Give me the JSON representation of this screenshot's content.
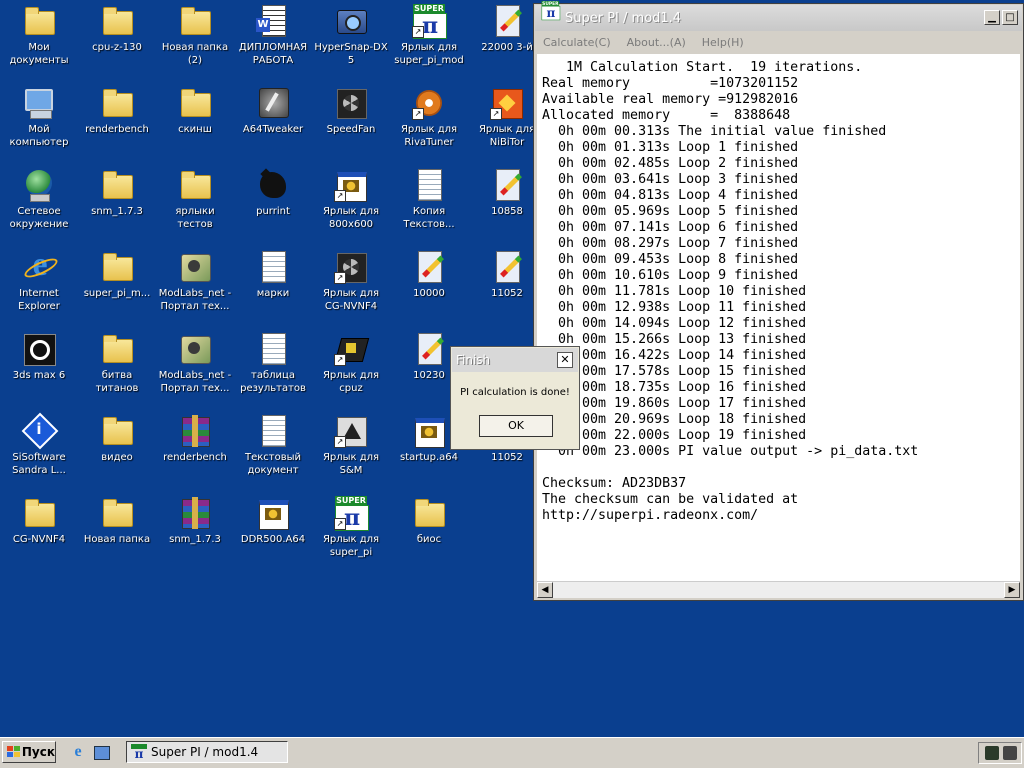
{
  "desktop": {
    "icons": [
      {
        "label": "Мои\nдокументы"
      },
      {
        "label": "cpu-z-130"
      },
      {
        "label": "Новая папка\n(2)"
      },
      {
        "label": "ДИПЛОМНАЯ\nРАБОТА"
      },
      {
        "label": "HyperSnap-DX\n5"
      },
      {
        "label": "Ярлык для\nsuper_pi_mod"
      },
      {
        "label": "22000 3-й"
      },
      {
        "label": "Мой\nкомпьютер"
      },
      {
        "label": "renderbench"
      },
      {
        "label": "скинш"
      },
      {
        "label": "A64Tweaker"
      },
      {
        "label": "SpeedFan"
      },
      {
        "label": "Ярлык для\nRivaTuner"
      },
      {
        "label": "Ярлык для\nNiBiTor"
      },
      {
        "label": "Сетевое\nокружение"
      },
      {
        "label": "snm_1.7.3"
      },
      {
        "label": "ярлыки\nтестов"
      },
      {
        "label": "purrint"
      },
      {
        "label": "Ярлык для\n800x600"
      },
      {
        "label": "Копия\nТекстов..."
      },
      {
        "label": "10858"
      },
      {
        "label": "Internet\nExplorer"
      },
      {
        "label": "super_pi_m..."
      },
      {
        "label": "ModLabs_net -\nПортал тех..."
      },
      {
        "label": "марки"
      },
      {
        "label": "Ярлык для\nCG-NVNF4"
      },
      {
        "label": "10000"
      },
      {
        "label": "11052"
      },
      {
        "label": "3ds max 6"
      },
      {
        "label": "битва\nтитанов"
      },
      {
        "label": "ModLabs_net -\nПортал тех..."
      },
      {
        "label": "таблица\nрезультатов"
      },
      {
        "label": "Ярлык для\ncpuz"
      },
      {
        "label": "10230"
      },
      {
        "label": "SiSoftware\nSandra L..."
      },
      {
        "label": "видео"
      },
      {
        "label": "renderbench"
      },
      {
        "label": "Текстовый\nдокумент"
      },
      {
        "label": "Ярлык для\nS&M"
      },
      {
        "label": "startup.a64"
      },
      {
        "label": "11052"
      },
      {
        "label": "CG-NVNF4"
      },
      {
        "label": "Новая папка"
      },
      {
        "label": "snm_1.7.3"
      },
      {
        "label": "DDR500.A64"
      },
      {
        "label": "Ярлык для\nsuper_pi"
      },
      {
        "label": "биос"
      }
    ]
  },
  "window": {
    "title": "Super PI / mod1.4",
    "menu": {
      "calculate": "Calculate(C)",
      "about": "About...(A)",
      "help": "Help(H)"
    },
    "console_text": "   1M Calculation Start.  19 iterations.\nReal memory          =1073201152\nAvailable real memory =912982016\nAllocated memory     =  8388648\n  0h 00m 00.313s The initial value finished\n  0h 00m 01.313s Loop 1 finished\n  0h 00m 02.485s Loop 2 finished\n  0h 00m 03.641s Loop 3 finished\n  0h 00m 04.813s Loop 4 finished\n  0h 00m 05.969s Loop 5 finished\n  0h 00m 07.141s Loop 6 finished\n  0h 00m 08.297s Loop 7 finished\n  0h 00m 09.453s Loop 8 finished\n  0h 00m 10.610s Loop 9 finished\n  0h 00m 11.781s Loop 10 finished\n  0h 00m 12.938s Loop 11 finished\n  0h 00m 14.094s Loop 12 finished\n  0h 00m 15.266s Loop 13 finished\n  0h 00m 16.422s Loop 14 finished\n  0h 00m 17.578s Loop 15 finished\n  0h 00m 18.735s Loop 16 finished\n  0h 00m 19.860s Loop 17 finished\n  0h 00m 20.969s Loop 18 finished\n  0h 00m 22.000s Loop 19 finished\n  0h 00m 23.000s PI value output -> pi_data.txt\n\nChecksum: AD23DB37\nThe checksum can be validated at\nhttp://superpi.radeonx.com/"
  },
  "dialog": {
    "title": "Finish",
    "message": "PI calculation is done!",
    "ok_label": "OK",
    "close_glyph": "✕"
  },
  "taskbar": {
    "start_label": "Пуск",
    "task_label": "Super PI / mod1.4"
  },
  "colors": {
    "desktop_bg": "#0a3f8f",
    "console_bg": "#ffffff"
  }
}
